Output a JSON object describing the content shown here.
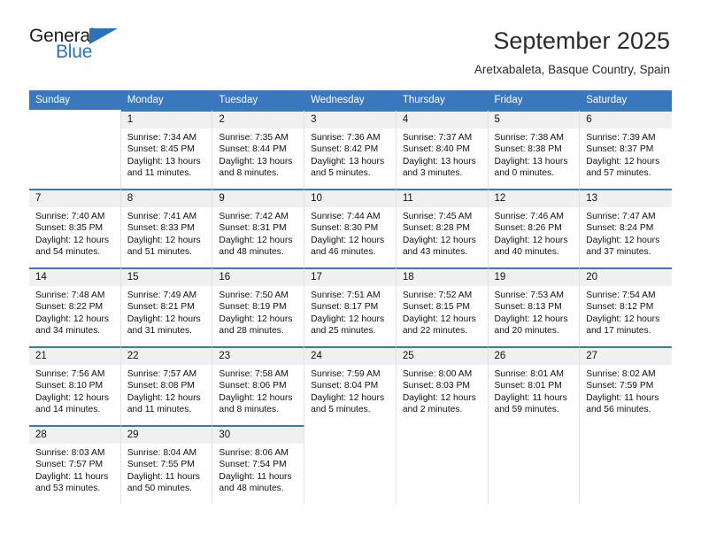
{
  "branding": {
    "logo_primary": "General",
    "logo_secondary": "Blue",
    "logo_icon": "triangle-icon"
  },
  "header": {
    "title": "September 2025",
    "subtitle": "Aretxabaleta, Basque Country, Spain"
  },
  "colors": {
    "header_blue": "#3b77bd",
    "logo_blue": "#2a73bb",
    "daynum_bg": "#f0f0f0",
    "cell_border": "#e2e2e2"
  },
  "weekdays": [
    "Sunday",
    "Monday",
    "Tuesday",
    "Wednesday",
    "Thursday",
    "Friday",
    "Saturday"
  ],
  "labels": {
    "sunrise_prefix": "Sunrise:",
    "sunset_prefix": "Sunset:",
    "daylight_prefix": "Daylight:"
  },
  "weeks": [
    [
      {
        "empty": true
      },
      {
        "day": "1",
        "sunrise": "Sunrise: 7:34 AM",
        "sunset": "Sunset: 8:45 PM",
        "daylight": "Daylight: 13 hours and 11 minutes."
      },
      {
        "day": "2",
        "sunrise": "Sunrise: 7:35 AM",
        "sunset": "Sunset: 8:44 PM",
        "daylight": "Daylight: 13 hours and 8 minutes."
      },
      {
        "day": "3",
        "sunrise": "Sunrise: 7:36 AM",
        "sunset": "Sunset: 8:42 PM",
        "daylight": "Daylight: 13 hours and 5 minutes."
      },
      {
        "day": "4",
        "sunrise": "Sunrise: 7:37 AM",
        "sunset": "Sunset: 8:40 PM",
        "daylight": "Daylight: 13 hours and 3 minutes."
      },
      {
        "day": "5",
        "sunrise": "Sunrise: 7:38 AM",
        "sunset": "Sunset: 8:38 PM",
        "daylight": "Daylight: 13 hours and 0 minutes."
      },
      {
        "day": "6",
        "sunrise": "Sunrise: 7:39 AM",
        "sunset": "Sunset: 8:37 PM",
        "daylight": "Daylight: 12 hours and 57 minutes."
      }
    ],
    [
      {
        "day": "7",
        "sunrise": "Sunrise: 7:40 AM",
        "sunset": "Sunset: 8:35 PM",
        "daylight": "Daylight: 12 hours and 54 minutes."
      },
      {
        "day": "8",
        "sunrise": "Sunrise: 7:41 AM",
        "sunset": "Sunset: 8:33 PM",
        "daylight": "Daylight: 12 hours and 51 minutes."
      },
      {
        "day": "9",
        "sunrise": "Sunrise: 7:42 AM",
        "sunset": "Sunset: 8:31 PM",
        "daylight": "Daylight: 12 hours and 48 minutes."
      },
      {
        "day": "10",
        "sunrise": "Sunrise: 7:44 AM",
        "sunset": "Sunset: 8:30 PM",
        "daylight": "Daylight: 12 hours and 46 minutes."
      },
      {
        "day": "11",
        "sunrise": "Sunrise: 7:45 AM",
        "sunset": "Sunset: 8:28 PM",
        "daylight": "Daylight: 12 hours and 43 minutes."
      },
      {
        "day": "12",
        "sunrise": "Sunrise: 7:46 AM",
        "sunset": "Sunset: 8:26 PM",
        "daylight": "Daylight: 12 hours and 40 minutes."
      },
      {
        "day": "13",
        "sunrise": "Sunrise: 7:47 AM",
        "sunset": "Sunset: 8:24 PM",
        "daylight": "Daylight: 12 hours and 37 minutes."
      }
    ],
    [
      {
        "day": "14",
        "sunrise": "Sunrise: 7:48 AM",
        "sunset": "Sunset: 8:22 PM",
        "daylight": "Daylight: 12 hours and 34 minutes."
      },
      {
        "day": "15",
        "sunrise": "Sunrise: 7:49 AM",
        "sunset": "Sunset: 8:21 PM",
        "daylight": "Daylight: 12 hours and 31 minutes."
      },
      {
        "day": "16",
        "sunrise": "Sunrise: 7:50 AM",
        "sunset": "Sunset: 8:19 PM",
        "daylight": "Daylight: 12 hours and 28 minutes."
      },
      {
        "day": "17",
        "sunrise": "Sunrise: 7:51 AM",
        "sunset": "Sunset: 8:17 PM",
        "daylight": "Daylight: 12 hours and 25 minutes."
      },
      {
        "day": "18",
        "sunrise": "Sunrise: 7:52 AM",
        "sunset": "Sunset: 8:15 PM",
        "daylight": "Daylight: 12 hours and 22 minutes."
      },
      {
        "day": "19",
        "sunrise": "Sunrise: 7:53 AM",
        "sunset": "Sunset: 8:13 PM",
        "daylight": "Daylight: 12 hours and 20 minutes."
      },
      {
        "day": "20",
        "sunrise": "Sunrise: 7:54 AM",
        "sunset": "Sunset: 8:12 PM",
        "daylight": "Daylight: 12 hours and 17 minutes."
      }
    ],
    [
      {
        "day": "21",
        "sunrise": "Sunrise: 7:56 AM",
        "sunset": "Sunset: 8:10 PM",
        "daylight": "Daylight: 12 hours and 14 minutes."
      },
      {
        "day": "22",
        "sunrise": "Sunrise: 7:57 AM",
        "sunset": "Sunset: 8:08 PM",
        "daylight": "Daylight: 12 hours and 11 minutes."
      },
      {
        "day": "23",
        "sunrise": "Sunrise: 7:58 AM",
        "sunset": "Sunset: 8:06 PM",
        "daylight": "Daylight: 12 hours and 8 minutes."
      },
      {
        "day": "24",
        "sunrise": "Sunrise: 7:59 AM",
        "sunset": "Sunset: 8:04 PM",
        "daylight": "Daylight: 12 hours and 5 minutes."
      },
      {
        "day": "25",
        "sunrise": "Sunrise: 8:00 AM",
        "sunset": "Sunset: 8:03 PM",
        "daylight": "Daylight: 12 hours and 2 minutes."
      },
      {
        "day": "26",
        "sunrise": "Sunrise: 8:01 AM",
        "sunset": "Sunset: 8:01 PM",
        "daylight": "Daylight: 11 hours and 59 minutes."
      },
      {
        "day": "27",
        "sunrise": "Sunrise: 8:02 AM",
        "sunset": "Sunset: 7:59 PM",
        "daylight": "Daylight: 11 hours and 56 minutes."
      }
    ],
    [
      {
        "day": "28",
        "sunrise": "Sunrise: 8:03 AM",
        "sunset": "Sunset: 7:57 PM",
        "daylight": "Daylight: 11 hours and 53 minutes."
      },
      {
        "day": "29",
        "sunrise": "Sunrise: 8:04 AM",
        "sunset": "Sunset: 7:55 PM",
        "daylight": "Daylight: 11 hours and 50 minutes."
      },
      {
        "day": "30",
        "sunrise": "Sunrise: 8:06 AM",
        "sunset": "Sunset: 7:54 PM",
        "daylight": "Daylight: 11 hours and 48 minutes."
      },
      {
        "empty": true
      },
      {
        "empty": true
      },
      {
        "empty": true
      },
      {
        "empty": true
      }
    ]
  ]
}
